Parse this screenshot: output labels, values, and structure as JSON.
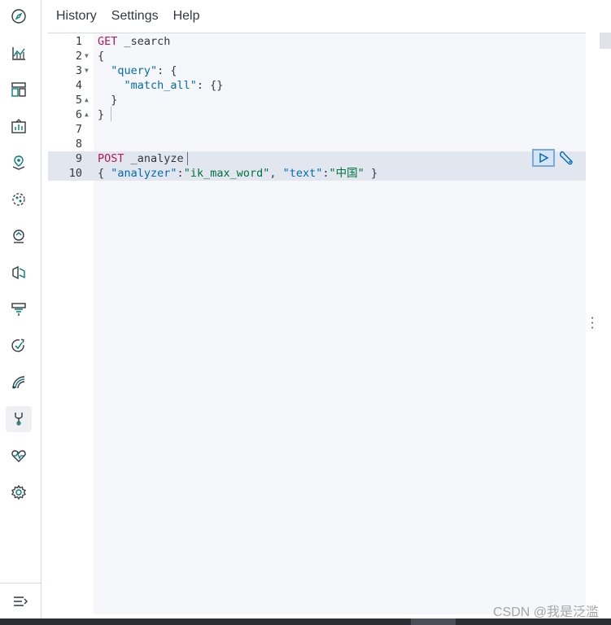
{
  "menu": {
    "history": "History",
    "settings": "Settings",
    "help": "Help"
  },
  "nav": {
    "icons": [
      "discover-compass-icon",
      "visualize-chart-icon",
      "dashboard-icon",
      "canvas-icon",
      "maps-icon",
      "ml-icon",
      "graph-icon",
      "infrastructure-icon",
      "logs-icon",
      "uptime-icon",
      "apm-icon",
      "dev-tools-icon",
      "monitoring-icon",
      "management-gear-icon"
    ],
    "collapse_icon": "collapse-menu-icon"
  },
  "editor": {
    "lines": [
      {
        "num": "1",
        "text": "GET _search"
      },
      {
        "num": "2",
        "text": "{"
      },
      {
        "num": "3",
        "text": "  \"query\": {"
      },
      {
        "num": "4",
        "text": "    \"match_all\": {}"
      },
      {
        "num": "5",
        "text": "  }"
      },
      {
        "num": "6",
        "text": "}"
      },
      {
        "num": "7",
        "text": ""
      },
      {
        "num": "8",
        "text": ""
      },
      {
        "num": "9",
        "text": "POST _analyze"
      },
      {
        "num": "10",
        "text": "{ \"analyzer\":\"ik_max_word\", \"text\":\"中国\" }"
      }
    ],
    "run_icon": "play-icon",
    "settings_icon": "wrench-icon"
  },
  "watermark": "CSDN @我是泛滥",
  "colors": {
    "keyword": "#b5185a",
    "string": "#00733e",
    "key": "#006bb8",
    "accent": "#017d73"
  }
}
